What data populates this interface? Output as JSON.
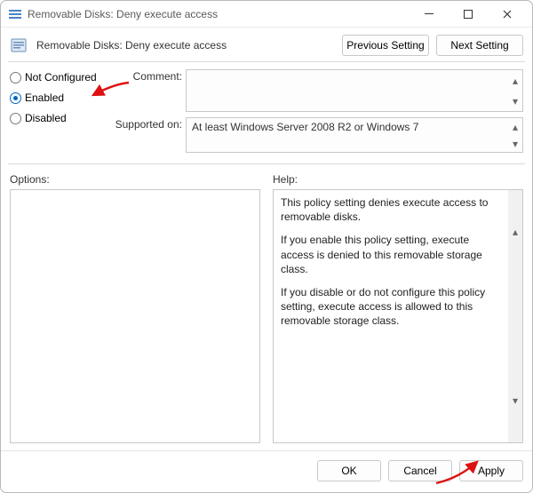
{
  "window": {
    "title": "Removable Disks: Deny execute access"
  },
  "header": {
    "policy_name": "Removable Disks: Deny execute access",
    "previous_btn": "Previous Setting",
    "next_btn": "Next Setting"
  },
  "state_options": {
    "not_configured": "Not Configured",
    "enabled": "Enabled",
    "disabled": "Disabled",
    "selected": "enabled"
  },
  "fields": {
    "comment_label": "Comment:",
    "comment_value": "",
    "supported_label": "Supported on:",
    "supported_value": "At least Windows Server 2008 R2 or Windows 7"
  },
  "sections": {
    "options_label": "Options:",
    "help_label": "Help:"
  },
  "help_text": {
    "p1": "This policy setting denies execute access to removable disks.",
    "p2": "If you enable this policy setting, execute access is denied to this removable storage class.",
    "p3": "If you disable or do not configure this policy setting, execute access is allowed to this removable storage class."
  },
  "footer": {
    "ok": "OK",
    "cancel": "Cancel",
    "apply": "Apply"
  }
}
